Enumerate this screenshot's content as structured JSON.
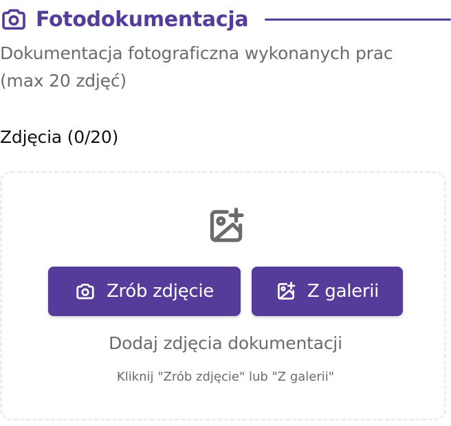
{
  "section": {
    "title": "Fotodokumentacja",
    "subtitle": "Dokumentacja fotograficzna wykonanych prac (max 20 zdjęć)",
    "header_icon": "camera-icon"
  },
  "photos": {
    "label": "Zdjęcia (0/20)",
    "dropzone_icon": "add-photo-icon",
    "empty_title": "Dodaj zdjęcia dokumentacji",
    "empty_hint": "Kliknij \"Zrób zdjęcie\" lub \"Z galerii\""
  },
  "buttons": {
    "camera_label": "Zrób zdjęcie",
    "camera_icon": "camera-icon",
    "gallery_label": "Z galerii",
    "gallery_icon": "add-photo-icon"
  },
  "colors": {
    "accent": "#553c9a",
    "muted_text": "#6b6b6b",
    "dropzone_border": "#eeeeee"
  }
}
